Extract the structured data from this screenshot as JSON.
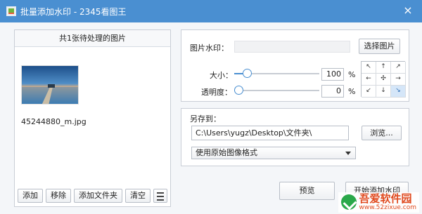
{
  "window": {
    "title": "批量添加水印 - 2345看图王",
    "close_symbol": "×"
  },
  "left_panel": {
    "header": "共1张待处理的图片",
    "file_name": "45244880_m.jpg",
    "buttons": {
      "add": "添加",
      "remove": "移除",
      "add_folder": "添加文件夹",
      "clear": "清空"
    }
  },
  "watermark": {
    "image_label": "图片水印：",
    "choose_label": "选择图片",
    "size_label": "大小：",
    "size_value": "100",
    "size_fraction": 0.11,
    "opacity_label": "透明度：",
    "opacity_value": "0",
    "opacity_fraction": 0.0,
    "percent": "%",
    "position_cells": [
      "↖",
      "↑",
      "↗",
      "←",
      "✣",
      "→",
      "↙",
      "↓",
      "↘"
    ],
    "position_selected": 8
  },
  "save": {
    "label": "另存到：",
    "path": "C:\\Users\\yugz\\Desktop\\文件夹\\",
    "browse_label": "浏览...",
    "format": "使用原始图像格式"
  },
  "actions": {
    "preview": "预览",
    "start": "开始添加水印"
  },
  "site_watermark": {
    "name": "吾爱软件园",
    "url": "www.52zixue.com"
  },
  "colors": {
    "titlebar": "#4a8fd1",
    "accent": "#4a8fd1"
  }
}
